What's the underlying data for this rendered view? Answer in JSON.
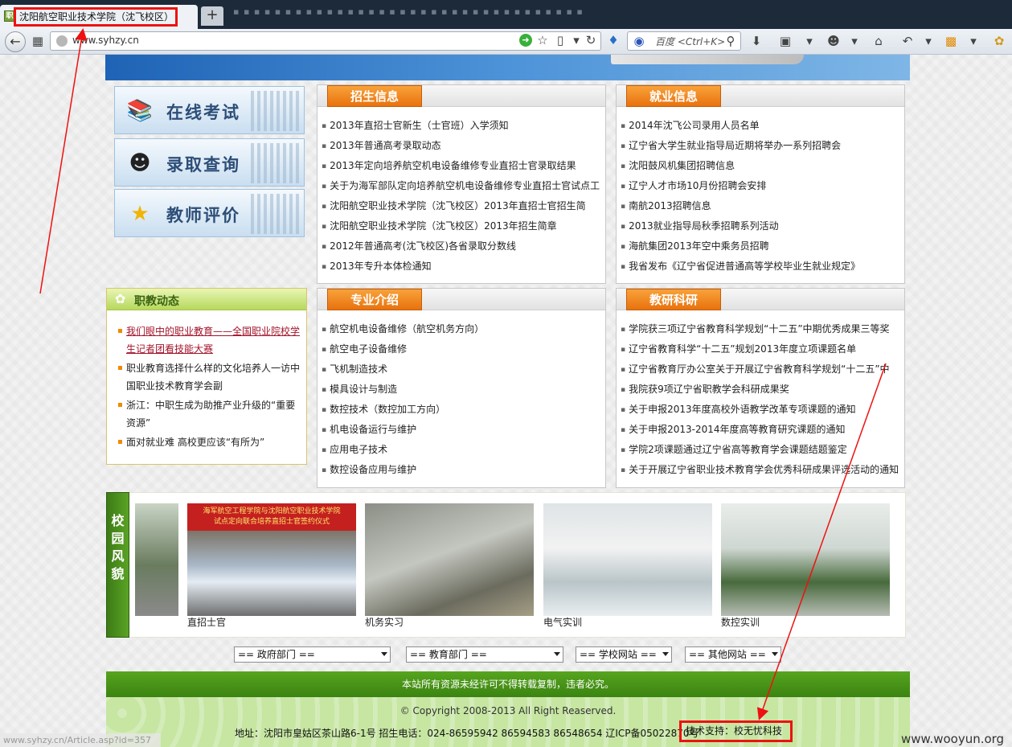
{
  "browser": {
    "tab_title": "沈阳航空职业技术学院（沈飞校区）",
    "tab_favicon": "职",
    "new_tab": "+",
    "background_tabs": "▪ ▪ ▪   ▪ ▪   ▪ ▪ ▪   ▪ ▪ ▪ ▪   ▪ ▪   ▪ ▪ ▪   ▪ ▪ ▪ ▪   ▪ ▪ ▪   ▪ ▪ ▪   ▪ ▪ ▪ ▪   ▪ ▪ ▪",
    "url": "www.syhzy.cn",
    "search_placeholder": "百度 <Ctrl+K>",
    "status_url": "www.syhzy.cn/Article.asp?id=357"
  },
  "left_nav": {
    "items": [
      {
        "label": "在线考试",
        "icon": "books-icon"
      },
      {
        "label": "录取查询",
        "icon": "person-icon"
      },
      {
        "label": "教师评价",
        "icon": "star-icon"
      }
    ]
  },
  "sections": {
    "zhaosheng": {
      "title": "招生信息",
      "items": [
        "2013年直招士官新生（士官班）入学须知",
        "2013年普通高考录取动态",
        "2013年定向培养航空机电设备维修专业直招士官录取结果",
        "关于为海军部队定向培养航空机电设备维修专业直招士官试点工",
        "沈阳航空职业技术学院（沈飞校区）2013年直招士官招生简",
        "沈阳航空职业技术学院（沈飞校区）2013年招生简章",
        "2012年普通高考(沈飞校区)各省录取分数线",
        "2013年专升本体检通知"
      ]
    },
    "jiuye": {
      "title": "就业信息",
      "items": [
        "2014年沈飞公司录用人员名单",
        "辽宁省大学生就业指导局近期将举办一系列招聘会",
        "沈阳鼓风机集团招聘信息",
        "辽宁人才市场10月份招聘会安排",
        "南航2013招聘信息",
        "2013就业指导局秋季招聘系列活动",
        "海航集团2013年空中乘务员招聘",
        "我省发布《辽宁省促进普通高等学校毕业生就业规定》"
      ]
    },
    "zhuanye": {
      "title": "专业介绍",
      "items": [
        "航空机电设备维修（航空机务方向）",
        "航空电子设备维修",
        "飞机制造技术",
        "模具设计与制造",
        "数控技术（数控加工方向）",
        "机电设备运行与维护",
        "应用电子技术",
        "数控设备应用与维护"
      ]
    },
    "jiaoyan": {
      "title": "教研科研",
      "items": [
        "学院获三项辽宁省教育科学规划“十二五”中期优秀成果三等奖",
        "辽宁省教育科学“十二五”规划2013年度立项课题名单",
        "辽宁省教育厅办公室关于开展辽宁省教育科学规划“十二五”中",
        "我院获9项辽宁省职教学会科研成果奖",
        "关于申报2013年度高校外语教学改革专项课题的通知",
        "关于申报2013-2014年度高等教育研究课题的通知",
        "学院2项课题通过辽宁省高等教育学会课题结题鉴定",
        "关于开展辽宁省职业技术教育学会优秀科研成果评选活动的通知"
      ]
    },
    "news": {
      "title": "职教动态",
      "items": [
        "我们眼中的职业教育——全国职业院校学生记者团看技能大赛",
        "职业教育选择什么样的文化培养人一访中国职业技术教育学会副",
        "浙江：中职生成为助推产业升级的“重要资源”",
        "面对就业难 高校更应该“有所为”"
      ]
    }
  },
  "campus": {
    "label": "校园风貌",
    "banner_text": "海军航空工程学院与沈阳航空职业技术学院\n试点定向联合培养直招士官签约仪式",
    "photos": [
      {
        "caption": "直招士官"
      },
      {
        "caption": "机务实习"
      },
      {
        "caption": "电气实训"
      },
      {
        "caption": "数控实训"
      }
    ]
  },
  "selects": [
    "==  政府部门  ==",
    "==  教育部门  ==",
    "==  学校网站  ==",
    "==  其他网站  =="
  ],
  "footer": {
    "notice": "本站所有资源未经许可不得转载复制，违者必究。",
    "copyright": "© Copyright 2008-2013 All Right Reaserved.",
    "address": "地址：沈阳市皇姑区茶山路6-1号 招生电话：024-86595942 86594583 86548654 辽ICP备05022870号",
    "tech_support": "技术支持：校无忧科技"
  },
  "watermark": "www.wooyun.org",
  "colors": {
    "orange_tab": "#e8720e",
    "green_bar": "#3b8311",
    "highlight_red": "#e11111"
  }
}
